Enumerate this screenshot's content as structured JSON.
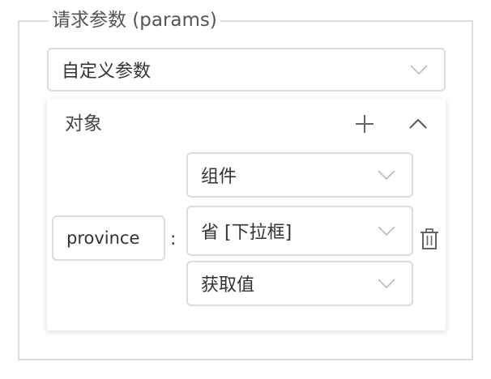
{
  "panel": {
    "legend": "请求参数 (params)"
  },
  "param_type_select": {
    "value": "自定义参数"
  },
  "object_card": {
    "title": "对象",
    "add_icon": "plus-icon",
    "collapse_icon": "chevron-up-icon",
    "key_input": {
      "value": "province",
      "placeholder": ""
    },
    "separator": ":",
    "source_select": {
      "value": "组件"
    },
    "component_select": {
      "value": "省 [下拉框]"
    },
    "value_mode_select": {
      "value": "获取值"
    },
    "delete_icon": "trash-icon"
  },
  "colors": {
    "border": "#dcdcdc",
    "text": "#333333",
    "icon": "#666666",
    "chevron": "#bbbbbb"
  }
}
